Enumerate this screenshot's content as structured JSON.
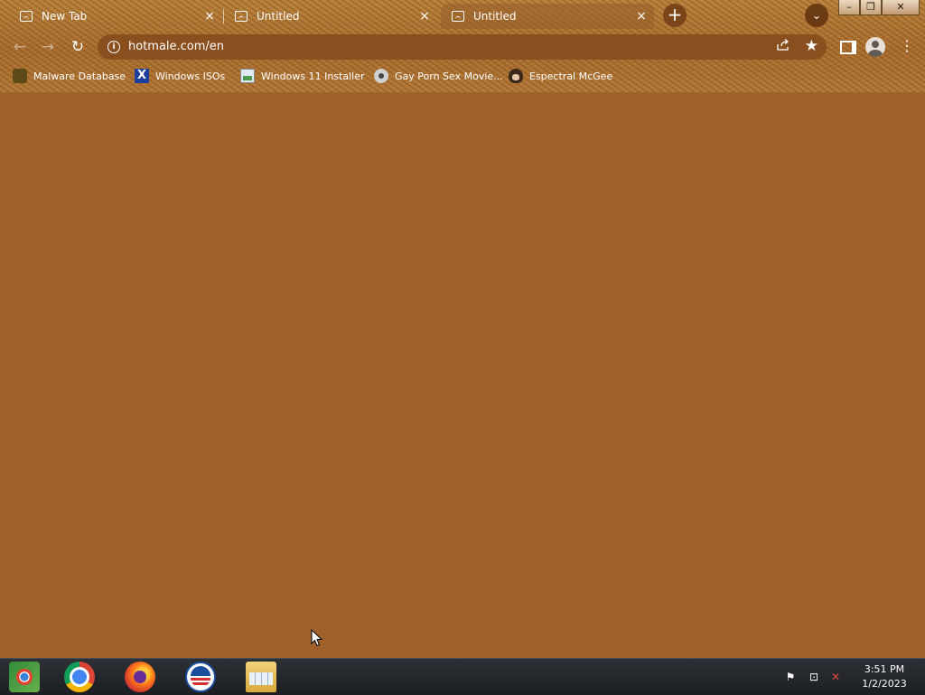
{
  "browser": {
    "tabs": [
      {
        "title": "New Tab",
        "close": "×",
        "active": false
      },
      {
        "title": "Untitled",
        "close": "×",
        "active": false
      },
      {
        "title": "Untitled",
        "close": "×",
        "active": true
      }
    ],
    "new_tab_symbol": "+",
    "tab_search_symbol": "⌄",
    "window_controls": {
      "minimize": "–",
      "maximize": "❐",
      "close": "✕"
    },
    "nav": {
      "back": "←",
      "forward": "→",
      "reload": "↻"
    },
    "omnibox": {
      "info_symbol": "i",
      "url": "hotmale.com/en"
    },
    "bookmarks": [
      {
        "label": "Malware Database",
        "icon": "malware-icon"
      },
      {
        "label": "Windows ISOs",
        "icon": "x-icon"
      },
      {
        "label": "Windows 11 Installer",
        "icon": "image-icon"
      },
      {
        "label": "Gay Porn Sex Movie...",
        "icon": "disc-icon"
      },
      {
        "label": "Espectral McGee",
        "icon": "face-icon"
      }
    ],
    "menu_symbol": "⋮",
    "page_background": "#a0622a"
  },
  "taskbar": {
    "apps": [
      "chromium-icon",
      "chrome-icon",
      "firefox-icon",
      "obama-icon",
      "file-explorer-icon"
    ],
    "tray": {
      "flag_symbol": "⚑",
      "network_symbol": "⊡",
      "volume_symbol": "✕"
    },
    "clock": {
      "time": "3:51 PM",
      "date": "1/2/2023"
    }
  }
}
